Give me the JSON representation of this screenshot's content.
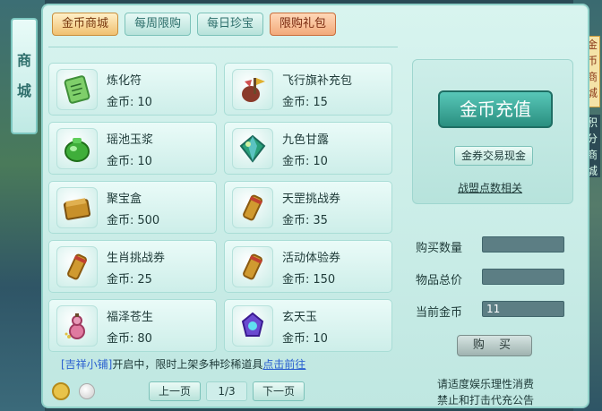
{
  "side_tab": {
    "label_1": "商",
    "label_2": "城"
  },
  "right_edge": {
    "label_top": "金币商城",
    "label_mid": "积分商城"
  },
  "tabs": [
    {
      "label": "金币商城",
      "state": "active"
    },
    {
      "label": "每周限购",
      "state": "normal"
    },
    {
      "label": "每日珍宝",
      "state": "normal"
    },
    {
      "label": "限购礼包",
      "state": "limit"
    }
  ],
  "items": [
    {
      "name": "炼化符",
      "price_label": "金币:",
      "price": "10",
      "icon": "talisman-icon",
      "color": "#6fbf6a"
    },
    {
      "name": "飞行旗补充包",
      "price_label": "金币:",
      "price": "15",
      "icon": "flag-pouch-icon",
      "color": "#8a3a2a"
    },
    {
      "name": "瑶池玉浆",
      "price_label": "金币:",
      "price": "10",
      "icon": "jade-pot-icon",
      "color": "#3fae3a"
    },
    {
      "name": "九色甘露",
      "price_label": "金币:",
      "price": "10",
      "icon": "nectar-gem-icon",
      "color": "#2aa07a"
    },
    {
      "name": "聚宝盒",
      "price_label": "金币:",
      "price": "500",
      "icon": "treasure-box-icon",
      "color": "#c8902a"
    },
    {
      "name": "天罡挑战券",
      "price_label": "金币:",
      "price": "35",
      "icon": "scroll-icon",
      "color": "#d09a30"
    },
    {
      "name": "生肖挑战券",
      "price_label": "金币:",
      "price": "25",
      "icon": "scroll-icon",
      "color": "#d09a30"
    },
    {
      "name": "活动体验券",
      "price_label": "金币:",
      "price": "150",
      "icon": "scroll-icon",
      "color": "#d09a30"
    },
    {
      "name": "福泽苍生",
      "price_label": "金币:",
      "price": "80",
      "icon": "gourd-icon",
      "color": "#e07aa0"
    },
    {
      "name": "玄天玉",
      "price_label": "金币:",
      "price": "10",
      "icon": "purple-jade-icon",
      "color": "#6a4ad0"
    }
  ],
  "notice": {
    "bracket_text": "[吉祥小铺]",
    "body_text": "开启中，限时上架多种珍稀道具",
    "link_text": "点击前往"
  },
  "pager": {
    "prev_label": "上一页",
    "page": "1/3",
    "next_label": "下一页"
  },
  "right_panel": {
    "recharge_label": "金币充值",
    "exchange_label": "金券交易现金",
    "points_link": "战盟点数相关"
  },
  "form": {
    "qty_label": "购买数量",
    "qty_value": "",
    "total_label": "物品总价",
    "total_value": "",
    "current_label": "当前金币",
    "current_value": "11"
  },
  "buy_label": "购 买",
  "footer": {
    "line1": "请适度娱乐理性消费",
    "line2": "禁止和打击代充公告"
  }
}
